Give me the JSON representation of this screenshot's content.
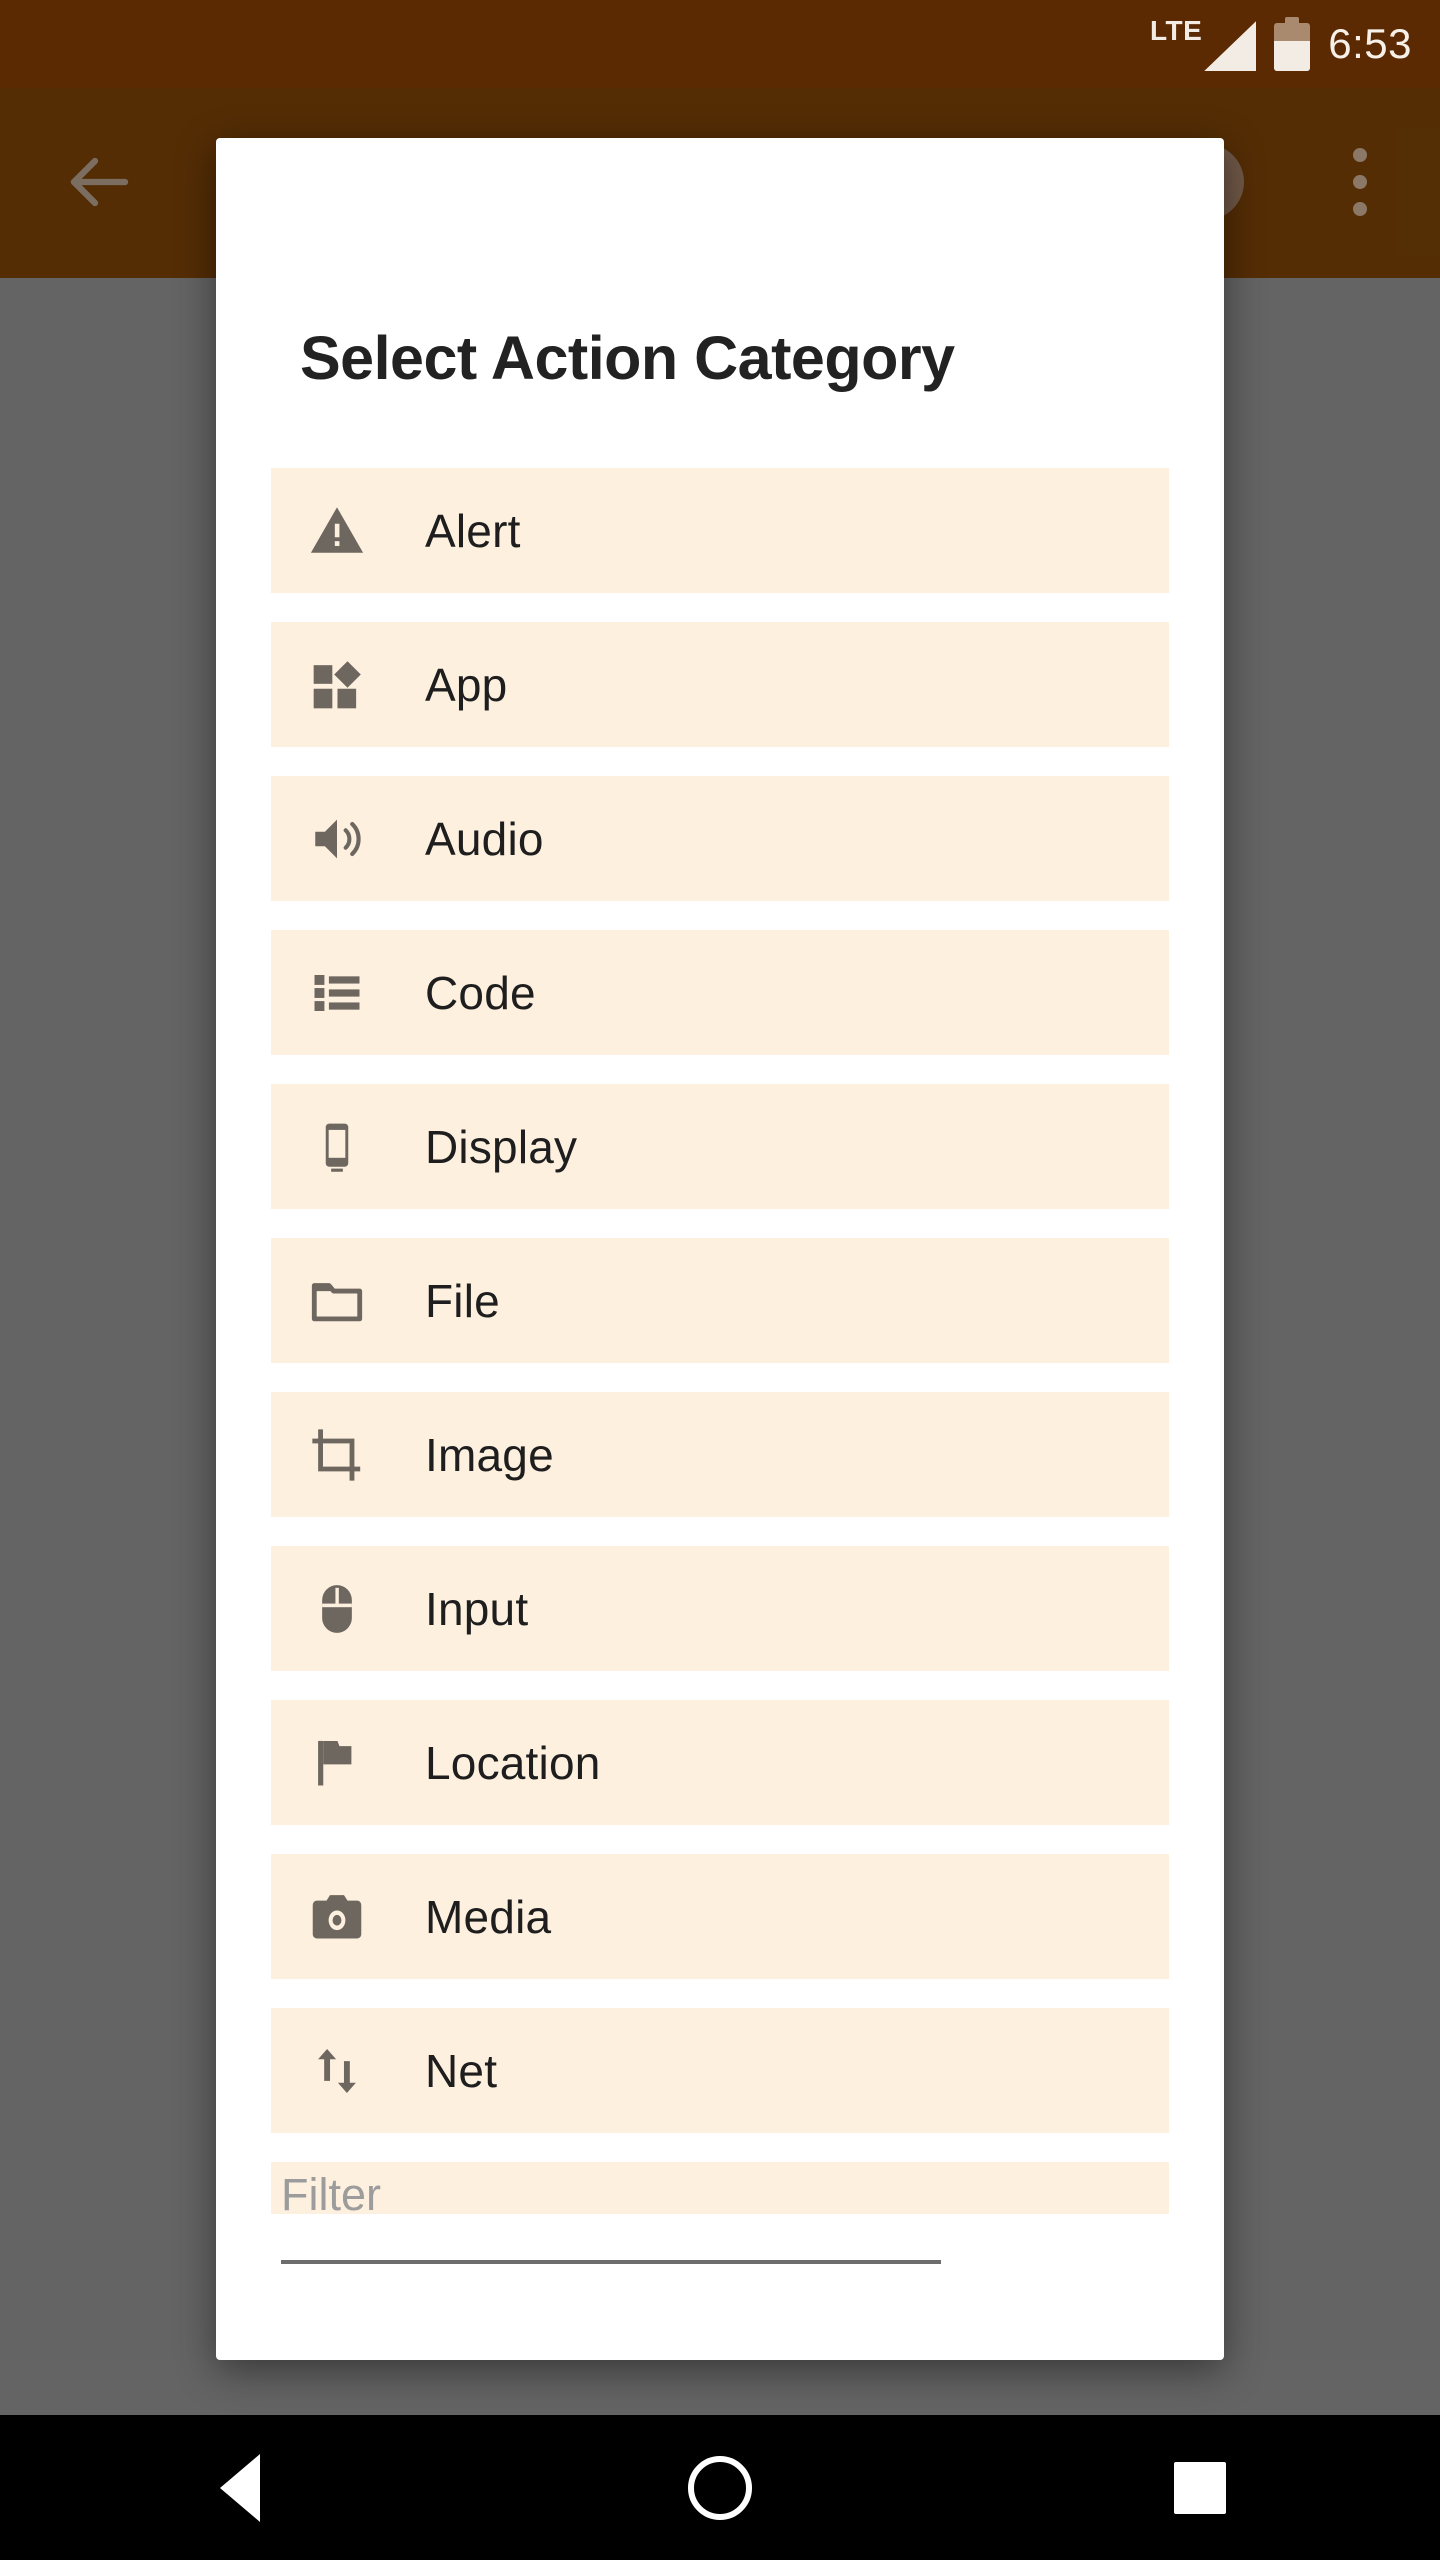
{
  "statusbar": {
    "network_label": "LTE",
    "time": "6:53",
    "signal_icon": "signal-bars-icon",
    "battery_icon": "battery-icon"
  },
  "appbar": {
    "back_icon": "back-arrow-icon",
    "close_icon": "close-circle-icon",
    "close_glyph": "✕",
    "overflow_icon": "overflow-menu-icon"
  },
  "dialog": {
    "title": "Select Action Category",
    "items": [
      {
        "label": "Alert",
        "icon": "warning-triangle-icon"
      },
      {
        "label": "App",
        "icon": "widgets-icon"
      },
      {
        "label": "Audio",
        "icon": "volume-speaker-icon"
      },
      {
        "label": "Code",
        "icon": "list-view-icon"
      },
      {
        "label": "Display",
        "icon": "smartphone-icon"
      },
      {
        "label": "File",
        "icon": "folder-icon"
      },
      {
        "label": "Image",
        "icon": "crop-icon"
      },
      {
        "label": "Input",
        "icon": "mouse-icon"
      },
      {
        "label": "Location",
        "icon": "flag-icon"
      },
      {
        "label": "Media",
        "icon": "camera-icon"
      },
      {
        "label": "Net",
        "icon": "swap-vertical-arrows-icon"
      },
      {
        "label": "",
        "icon": ""
      }
    ],
    "filter": {
      "value": "",
      "placeholder": "Filter"
    },
    "grid_button_icon": "grid-view-icon"
  },
  "navbar": {
    "back_icon": "nav-back-icon",
    "home_icon": "nav-home-icon",
    "recents_icon": "nav-recents-icon"
  },
  "colors": {
    "statusbar": "#5c2a02",
    "appbar": "#5e3306",
    "scrim": "#646464",
    "row_background": "#fdf0df",
    "icon_gray": "#6e675f",
    "dialog_background": "#ffffff",
    "navbar": "#000000"
  }
}
